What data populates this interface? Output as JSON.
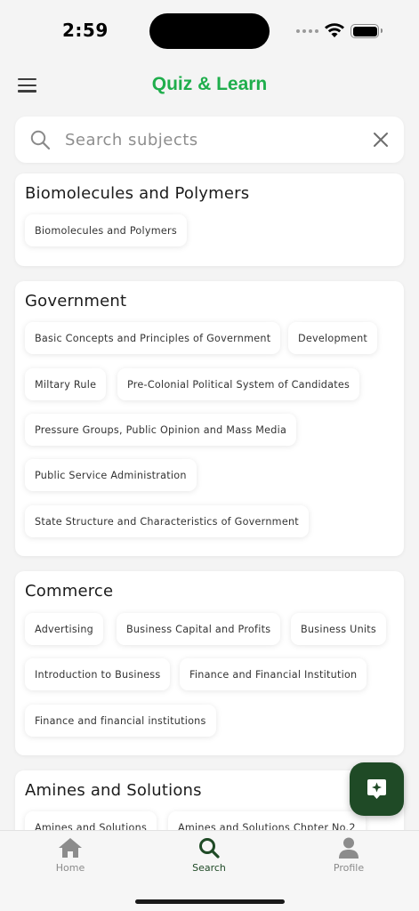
{
  "status_bar": {
    "time": "2:59"
  },
  "header": {
    "title": "Quiz & Learn"
  },
  "search": {
    "placeholder": "Search subjects",
    "value": ""
  },
  "subjects": [
    {
      "title": "Biomolecules and Polymers",
      "topics": [
        "Biomolecules and Polymers"
      ]
    },
    {
      "title": "Government",
      "topics": [
        "Basic Concepts and Principles of Government",
        "Development",
        "Miltary Rule",
        "Pre-Colonial Political System of Candidates",
        "Pressure Groups, Public Opinion and Mass Media",
        "Public Service Administration",
        "State Structure and Characteristics of Government"
      ]
    },
    {
      "title": "Commerce",
      "topics": [
        "Advertising",
        "Business Capital and Profits",
        "Business Units",
        "Introduction to Business",
        "Finance and Financial Institution",
        "Finance and financial institutions"
      ]
    },
    {
      "title": "Amines and Solutions",
      "topics": [
        "Amines and Solutions",
        "Amines and Solutions Chpter No.2"
      ]
    }
  ],
  "bottom_nav": {
    "items": [
      {
        "label": "Home",
        "icon": "home-icon"
      },
      {
        "label": "Search",
        "icon": "search-icon",
        "active": true
      },
      {
        "label": "Profile",
        "icon": "profile-icon"
      }
    ]
  },
  "colors": {
    "accent": "#1fae4c",
    "dark_green": "#1f4a26",
    "background": "#f4f4f4"
  }
}
